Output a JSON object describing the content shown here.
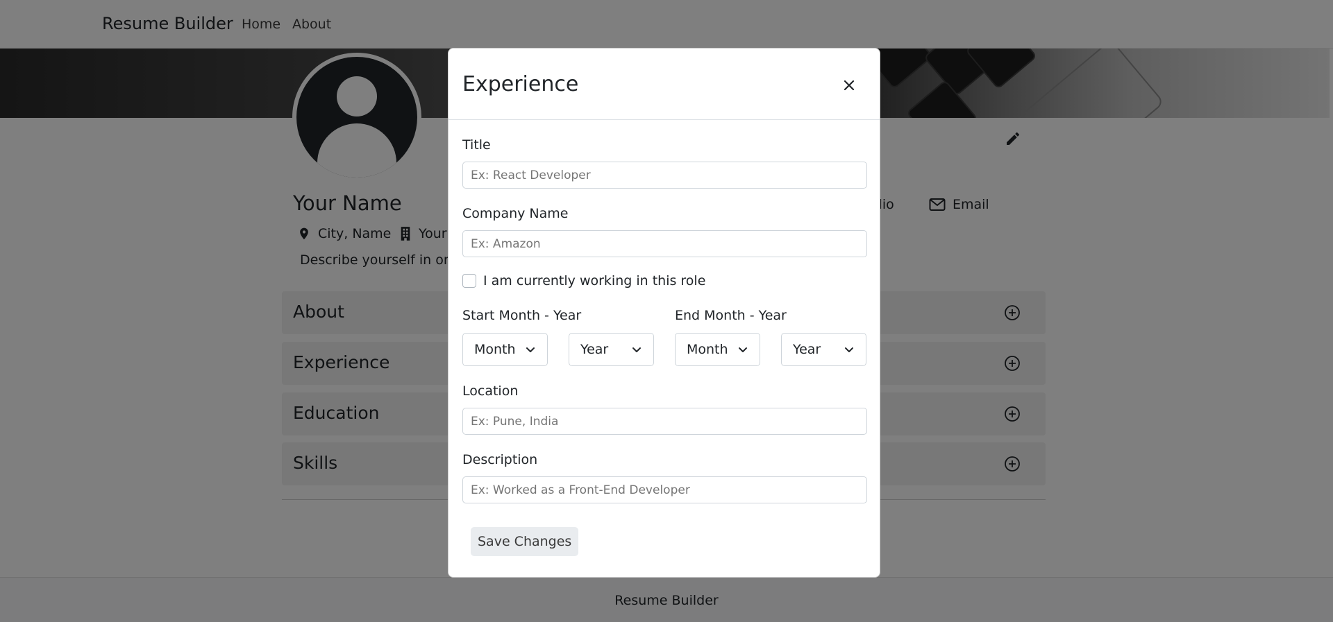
{
  "navbar": {
    "brand": "Resume Builder",
    "links": [
      "Home",
      "About"
    ]
  },
  "profile": {
    "name": "Your Name",
    "city": "City, Name",
    "company_partial": "Your",
    "tagline_partial": "Describe yourself in one",
    "portfolio_partial": "rtfolio",
    "email": "Email"
  },
  "sections": [
    "About",
    "Experience",
    "Education",
    "Skills"
  ],
  "footer": {
    "text": "Resume Builder"
  },
  "modal": {
    "title": "Experience",
    "fields": {
      "title": {
        "label": "Title",
        "placeholder": "Ex: React Developer",
        "value": ""
      },
      "company": {
        "label": "Company Name",
        "placeholder": "Ex: Amazon",
        "value": ""
      },
      "current_role": {
        "label": "I am currently working in this role",
        "checked": false
      },
      "start": {
        "label": "Start Month - Year",
        "month": "Month",
        "year": "Year"
      },
      "end": {
        "label": "End Month - Year",
        "month": "Month",
        "year": "Year"
      },
      "location": {
        "label": "Location",
        "placeholder": "Ex: Pune, India",
        "value": ""
      },
      "description": {
        "label": "Description",
        "placeholder": "Ex: Worked as a Front-End Developer",
        "value": ""
      }
    },
    "save_label": "Save Changes"
  },
  "colors": {
    "backdrop": "rgba(0,0,0,0.5)",
    "text": "#212529",
    "section_bg": "#f1f1f1",
    "button_bg": "#e9ecef"
  }
}
